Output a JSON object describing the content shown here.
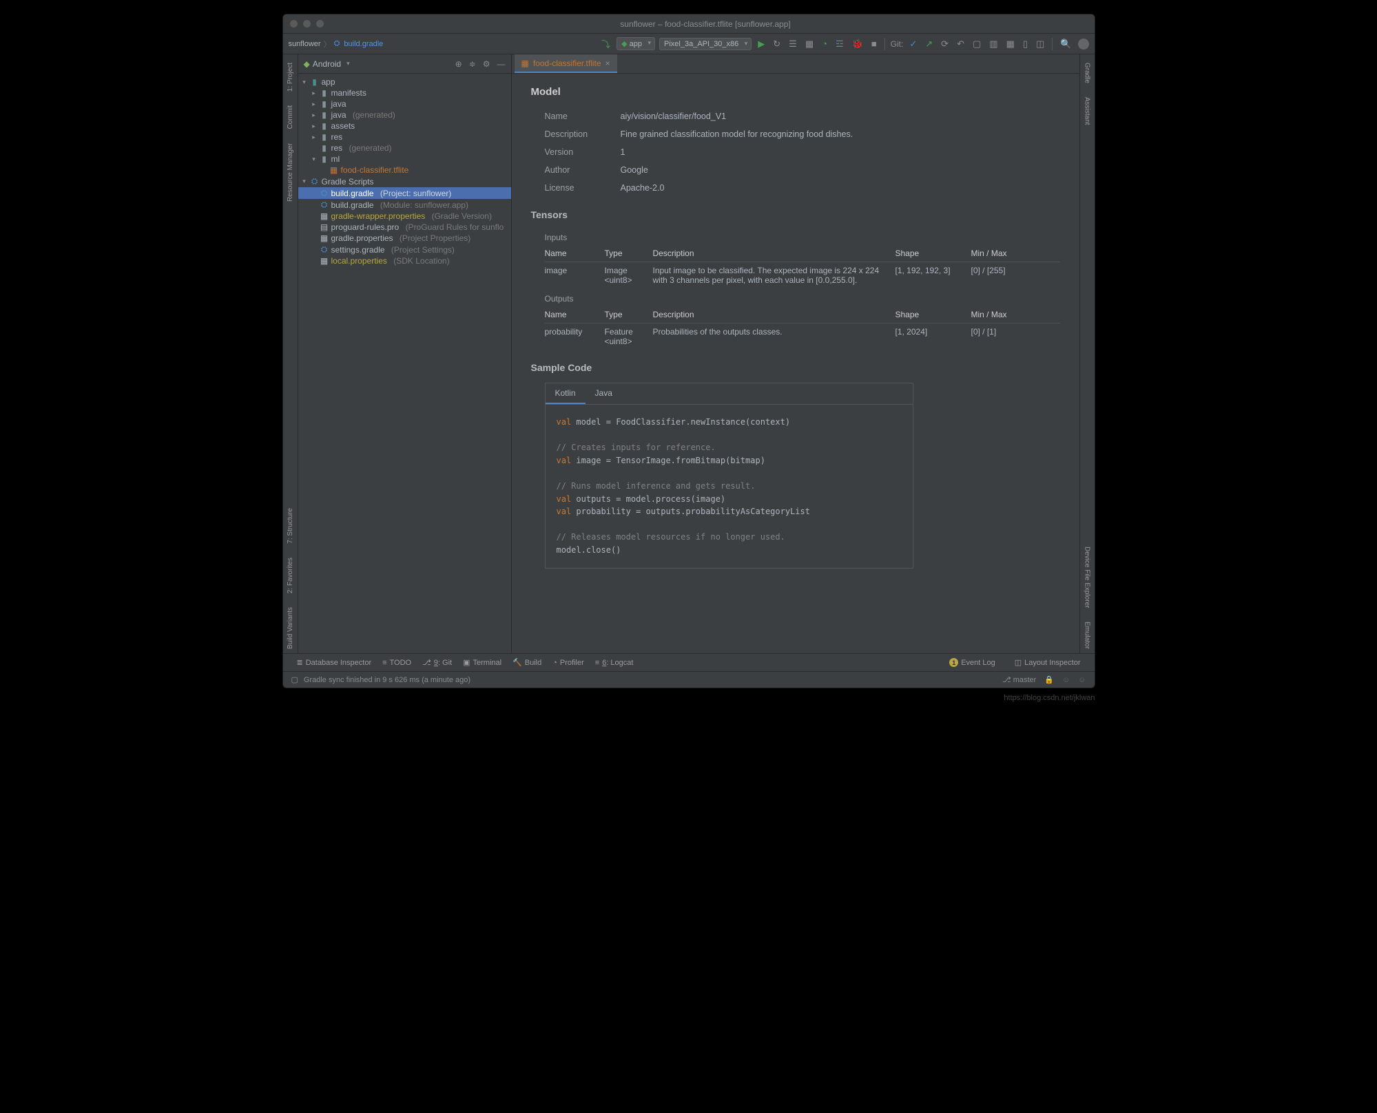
{
  "window_title": "sunflower – food-classifier.tflite [sunflower.app]",
  "breadcrumb": {
    "module": "sunflower",
    "file": "build.gradle"
  },
  "run_config": {
    "module": "app",
    "device": "Pixel_3a_API_30_x86"
  },
  "git_label": "Git:",
  "project_panel": {
    "dropdown": "Android",
    "tree": {
      "app": "app",
      "manifests": "manifests",
      "java": "java",
      "java_gen_label": "java",
      "generated": "(generated)",
      "assets": "assets",
      "res": "res",
      "res_gen_label": "res",
      "ml": "ml",
      "tflite": "food-classifier.tflite",
      "gradle_scripts": "Gradle Scripts",
      "build_gradle": "build.gradle",
      "build_proj": "(Project: sunflower)",
      "build_mod": "(Module: sunflower.app)",
      "wrapper": "gradle-wrapper.properties",
      "wrapper_hint": "(Gradle Version)",
      "proguard": "proguard-rules.pro",
      "proguard_hint": "(ProGuard Rules for sunflo",
      "gradle_props": "gradle.properties",
      "gradle_props_hint": "(Project Properties)",
      "settings": "settings.gradle",
      "settings_hint": "(Project Settings)",
      "local": "local.properties",
      "local_hint": "(SDK Location)"
    }
  },
  "editor_tab": "food-classifier.tflite",
  "model": {
    "heading": "Model",
    "name_label": "Name",
    "name": "aiy/vision/classifier/food_V1",
    "desc_label": "Description",
    "desc": "Fine grained classification model for recognizing food dishes.",
    "ver_label": "Version",
    "ver": "1",
    "author_label": "Author",
    "author": "Google",
    "license_label": "License",
    "license": "Apache-2.0"
  },
  "tensors": {
    "heading": "Tensors",
    "inputs_label": "Inputs",
    "outputs_label": "Outputs",
    "cols": {
      "name": "Name",
      "type": "Type",
      "desc": "Description",
      "shape": "Shape",
      "minmax": "Min / Max"
    },
    "input": {
      "name": "image",
      "type": "Image <uint8>",
      "desc": "Input image to be classified. The expected image is 224 x 224 with 3 channels per pixel, with each value in [0.0,255.0].",
      "shape": "[1, 192, 192, 3]",
      "minmax": "[0] / [255]"
    },
    "output": {
      "name": "probability",
      "type": "Feature <uint8>",
      "desc": "Probabilities of the outputs classes.",
      "shape": "[1, 2024]",
      "minmax": "[0] / [1]"
    }
  },
  "sample": {
    "heading": "Sample Code",
    "tab_kotlin": "Kotlin",
    "tab_java": "Java",
    "code": {
      "l1a": "val",
      "l1b": " model = FoodClassifier.newInstance(context)",
      "l2": "// Creates inputs for reference.",
      "l3a": "val",
      "l3b": " image = TensorImage.fromBitmap(bitmap)",
      "l4": "// Runs model inference and gets result.",
      "l5a": "val",
      "l5b": " outputs = model.process(image)",
      "l6a": "val",
      "l6b": " probability = outputs.probabilityAsCategoryList",
      "l7": "// Releases model resources if no longer used.",
      "l8": "model.close()"
    }
  },
  "bottom": {
    "db": "Database Inspector",
    "todo": "TODO",
    "git": "9: Git",
    "terminal": "Terminal",
    "build": "Build",
    "profiler": "Profiler",
    "logcat": "6: Logcat",
    "eventlog": "Event Log",
    "layoutinsp": "Layout Inspector"
  },
  "status": {
    "msg": "Gradle sync finished in 9 s 626 ms (a minute ago)",
    "branch": "master"
  },
  "gutter": {
    "left": [
      "1: Project",
      "Commit",
      "Resource Manager",
      "7: Structure",
      "2: Favorites",
      "Build Variants"
    ],
    "right": [
      "Gradle",
      "Assistant",
      "Device File Explorer",
      "Emulator"
    ]
  },
  "watermark": "https://blog.csdn.net/jklwan"
}
